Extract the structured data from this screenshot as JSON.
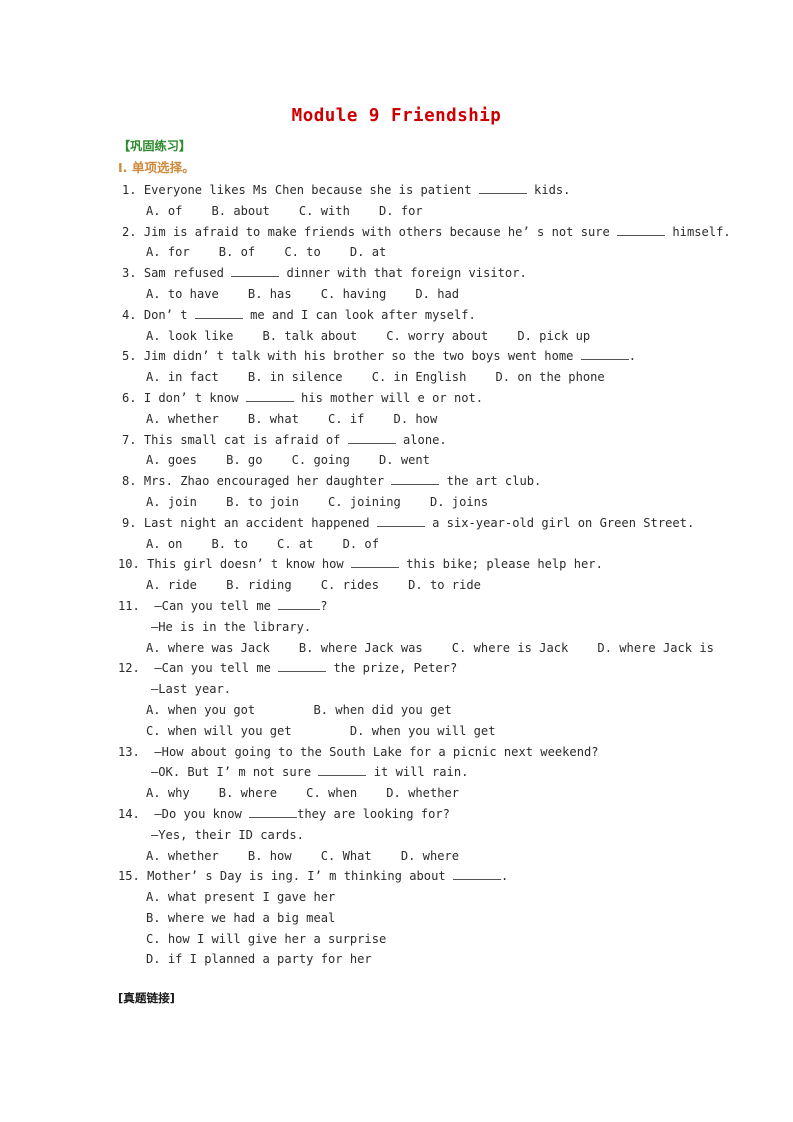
{
  "document": {
    "title": "Module 9 Friendship",
    "title_color": "#cc0000",
    "section_heading": "【巩固练习】",
    "section_heading_color": "#2f8a30",
    "part_heading": "I. 单项选择。",
    "part_heading_color": "#d08a3e",
    "footer_heading": "[真题链接]"
  },
  "questions": [
    {
      "number": "1.",
      "stem_before": "Everyone likes Ms Chen because she is patient ",
      "stem_after": " kids.",
      "options_line1": "A. of    B. about    C. with    D. for"
    },
    {
      "number": "2.",
      "stem_before": "Jim is afraid to make friends with others because he’ s not sure ",
      "stem_after": " himself.",
      "options_line1": "A. for    B. of    C. to    D. at"
    },
    {
      "number": "3.",
      "stem_before": "Sam refused ",
      "stem_after": " dinner with that foreign visitor.",
      "options_line1": "A. to have    B. has    C. having    D. had"
    },
    {
      "number": "4.",
      "stem_before": "Don’ t ",
      "stem_after": " me and I can look after myself.",
      "options_line1": "A. look like    B. talk about    C. worry about    D. pick up"
    },
    {
      "number": "5.",
      "stem_before": "Jim didn’ t talk with his brother so the two boys went home ",
      "stem_after": ".",
      "options_line1": "A. in fact    B. in silence    C. in English    D. on the phone"
    },
    {
      "number": "6.",
      "stem_before": "I don’ t know ",
      "stem_after": " his mother will e or not.",
      "options_line1": "A. whether    B. what    C. if    D. how"
    },
    {
      "number": "7.",
      "stem_before": "This small cat is afraid of ",
      "stem_after": " alone.",
      "options_line1": "A. goes    B. go    C. going    D. went"
    },
    {
      "number": "8.",
      "stem_before": "Mrs. Zhao encouraged her daughter ",
      "stem_after": " the art club.",
      "options_line1": "A. join    B. to join    C. joining    D. joins"
    },
    {
      "number": "9.",
      "stem_before": "Last night an accident happened ",
      "stem_after": " a six-year-old girl on Green Street.",
      "options_line1": "A. on    B. to    C. at    D. of"
    },
    {
      "number": "10.",
      "stem_before": "This girl doesn’ t know how ",
      "stem_after": " this bike; please help her.",
      "options_line1": "A. ride    B. riding    C. rides    D. to ride"
    },
    {
      "number": "11.",
      "stem_before": "—Can you tell me ",
      "stem_after": "?",
      "reply": "—He is in the library.",
      "options_line1": "A. where was Jack    B. where Jack was    C. where is Jack    D. where Jack is"
    },
    {
      "number": "12.",
      "stem_before": "—Can you tell me ",
      "stem_after": " the prize, Peter?",
      "reply": "—Last year.",
      "options_line1": "A. when you got        B. when did you get",
      "options_line2": "C. when will you get        D. when you will get"
    },
    {
      "number": "13.",
      "stem_full": "—How about going to the South Lake for a picnic next weekend?",
      "reply_before": "—OK. But I’ m not sure ",
      "reply_after": " it will rain.",
      "options_line1": "A. why    B. where    C. when    D. whether"
    },
    {
      "number": "14.",
      "stem_before": "—Do you know ",
      "stem_after": "they are looking for?",
      "reply": "—Yes, their ID cards.",
      "options_line1": "A. whether    B. how    C. What    D. where"
    },
    {
      "number": "15.",
      "stem_before": "Mother’ s Day is ing. I’ m thinking about ",
      "stem_after": ".",
      "options_line1": "A. what present I gave her",
      "options_line2": "B. where we had a big meal",
      "options_line3": "C. how I will give her a surprise",
      "options_line4": "D. if I planned a party for her"
    }
  ]
}
